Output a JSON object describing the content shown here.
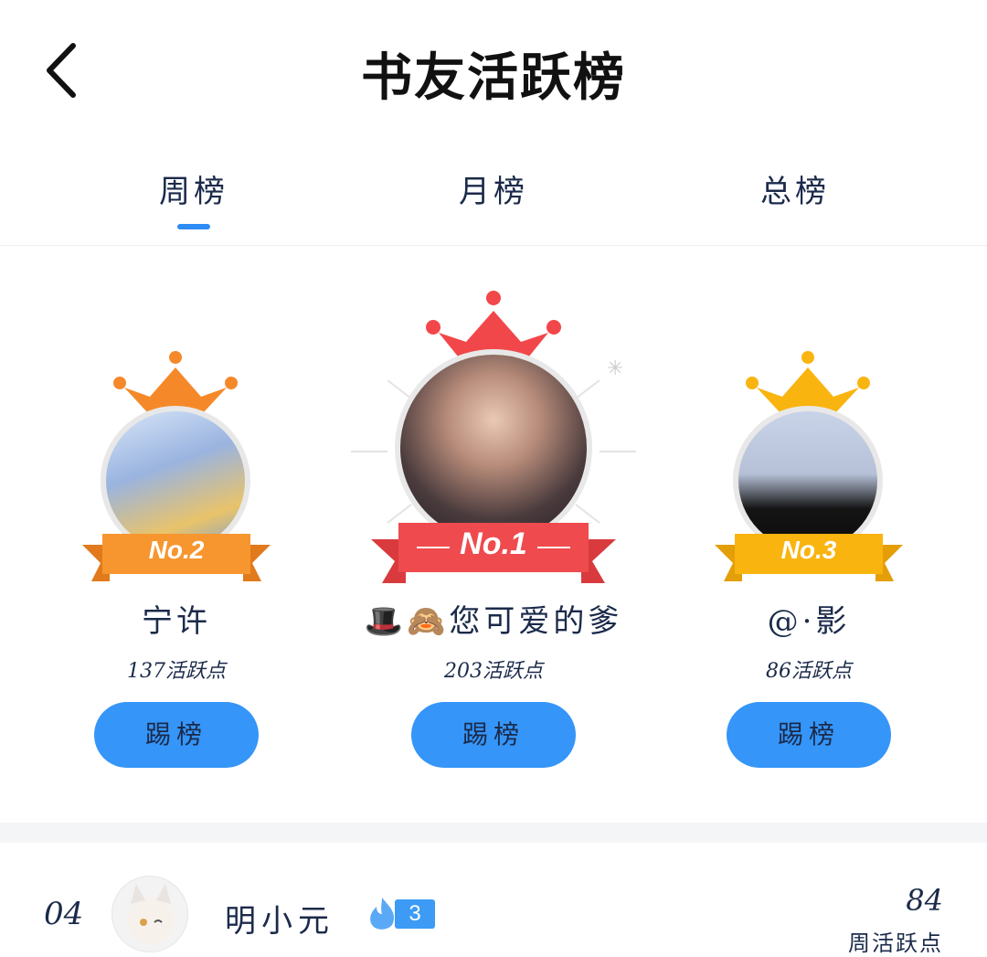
{
  "header": {
    "title": "书友活跃榜",
    "back_icon": "chevron-left-icon"
  },
  "tabs": [
    {
      "label": "周榜",
      "active": true
    },
    {
      "label": "月榜",
      "active": false
    },
    {
      "label": "总榜",
      "active": false
    }
  ],
  "podium": [
    {
      "rank_label": "No.2",
      "name": "宁许",
      "points": "137活跃点",
      "button_label": "踢榜",
      "crown_color": "#f5892a",
      "ribbon_color": "#f7962e"
    },
    {
      "rank_label": "No.1",
      "name": "🎩🙈您可爱的爹",
      "points": "203活跃点",
      "button_label": "踢榜",
      "crown_color": "#f2474a",
      "ribbon_color": "#ef4a4d"
    },
    {
      "rank_label": "No.3",
      "name": "@·影",
      "points": "86活跃点",
      "button_label": "踢榜",
      "crown_color": "#f9b410",
      "ribbon_color": "#f9b410"
    }
  ],
  "list": [
    {
      "rank": "04",
      "name": "明小元",
      "level": "3",
      "score": "84",
      "score_label": "周活跃点"
    }
  ],
  "colors": {
    "accent": "#2f8cf5",
    "button": "#3595f8",
    "text": "#1b2a4a"
  }
}
